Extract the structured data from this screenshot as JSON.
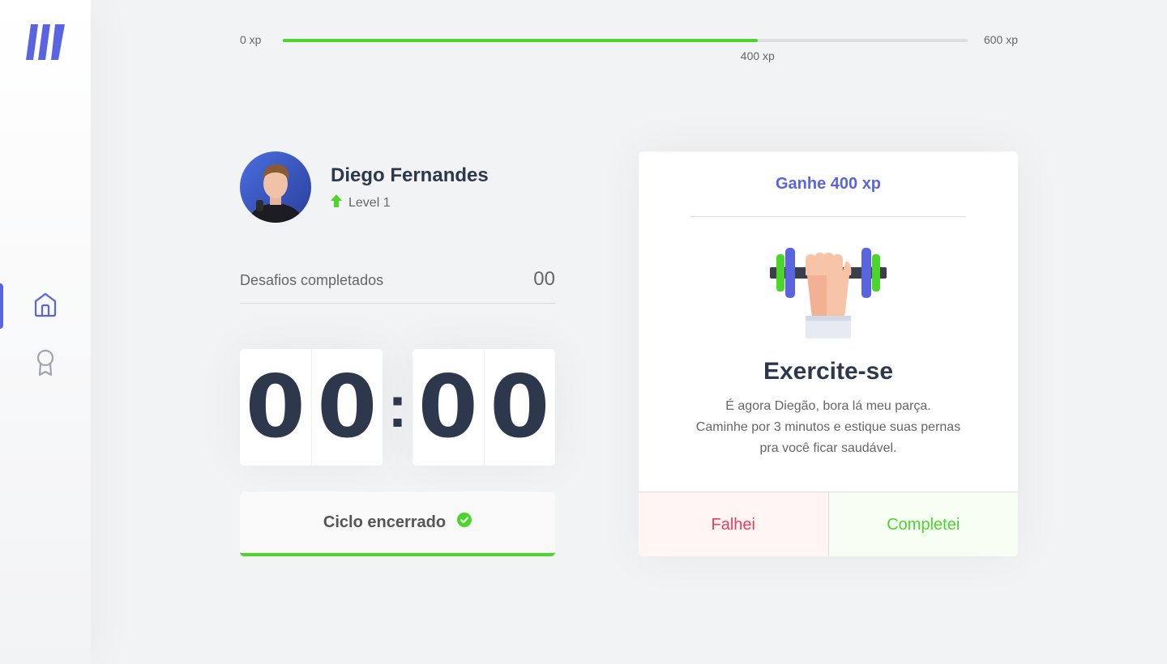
{
  "xp": {
    "min_label": "0 xp",
    "max_label": "600 xp",
    "current_label": "400 xp",
    "progress": 0.6933
  },
  "profile": {
    "name": "Diego Fernandes",
    "level_label": "Level 1"
  },
  "completed": {
    "label": "Desafios completados",
    "value": "00"
  },
  "countdown": {
    "minute_left": "0",
    "minute_right": "0",
    "separator": ":",
    "second_left": "0",
    "second_right": "0"
  },
  "cycle_button": {
    "label": "Ciclo encerrado"
  },
  "challenge": {
    "header": "Ganhe 400 xp",
    "title": "Exercite-se",
    "description_line1": "É agora Diegão, bora lá meu parça.",
    "description_line2": "Caminhe por 3 minutos e estique suas pernas",
    "description_line3": "pra você ficar saudável.",
    "fail_label": "Falhei",
    "success_label": "Completei"
  },
  "colors": {
    "accent": "#5965e0",
    "success": "#4cd62b",
    "danger": "#e83f5b",
    "title": "#2e384d",
    "text": "#666666",
    "background": "#f2f3f5"
  },
  "icons": {
    "logo": "moveit-logo",
    "nav_home": "home-icon",
    "nav_award": "award-icon",
    "level_up": "level-up-arrow-icon",
    "cycle_done": "check-circle-icon",
    "challenge": "dumbbell-body-icon"
  },
  "sidebar": {
    "active_item": "home"
  }
}
